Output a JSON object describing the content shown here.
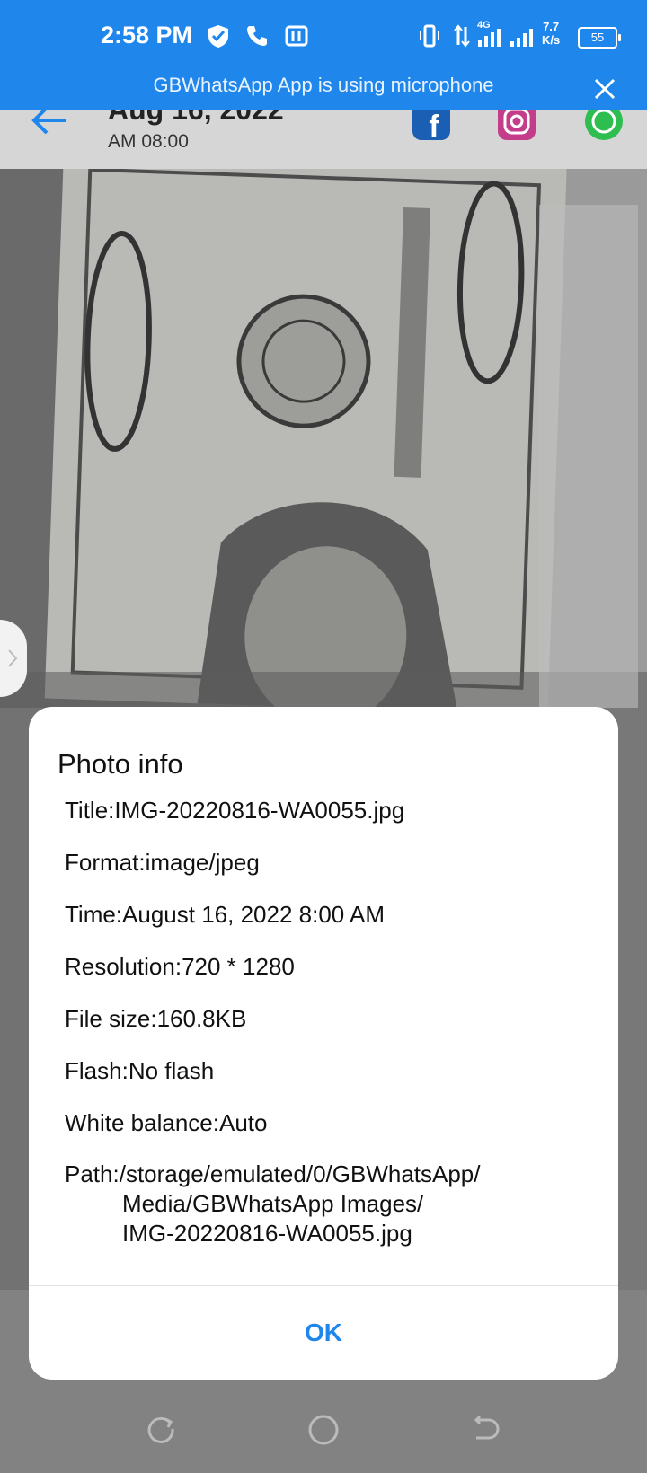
{
  "status_bar": {
    "time": "2:58 PM",
    "net_speed_value": "7.7",
    "net_speed_unit": "K/s",
    "network_type": "4G",
    "battery": "55"
  },
  "mic_banner": {
    "text": "GBWhatsApp App is using microphone"
  },
  "header": {
    "date": "Aug 16, 2022",
    "time": "AM 08:00",
    "share_targets": [
      "facebook",
      "instagram",
      "whatsapp"
    ]
  },
  "dialog": {
    "title": "Photo info",
    "rows": [
      {
        "label": "Title:",
        "value": "IMG-20220816-WA0055.jpg"
      },
      {
        "label": "Format:",
        "value": "image/jpeg"
      },
      {
        "label": "Time:",
        "value": "August 16, 2022 8:00 AM"
      },
      {
        "label": "Resolution:",
        "value": "720 * 1280"
      },
      {
        "label": "File size:",
        "value": "160.8KB"
      },
      {
        "label": "Flash:",
        "value": "No flash"
      },
      {
        "label": "White balance:",
        "value": "Auto"
      }
    ],
    "path_label": "Path:",
    "path_line1": "/storage/emulated/0/GBWhatsApp/",
    "path_line2": "Media/GBWhatsApp Images/",
    "path_line3": "IMG-20220816-WA0055.jpg",
    "ok_label": "OK"
  },
  "colors": {
    "accent": "#1f86ec",
    "dialog_bg": "#ffffff"
  },
  "nav": {
    "icons": [
      "recents-icon",
      "home-icon",
      "back-icon"
    ]
  }
}
